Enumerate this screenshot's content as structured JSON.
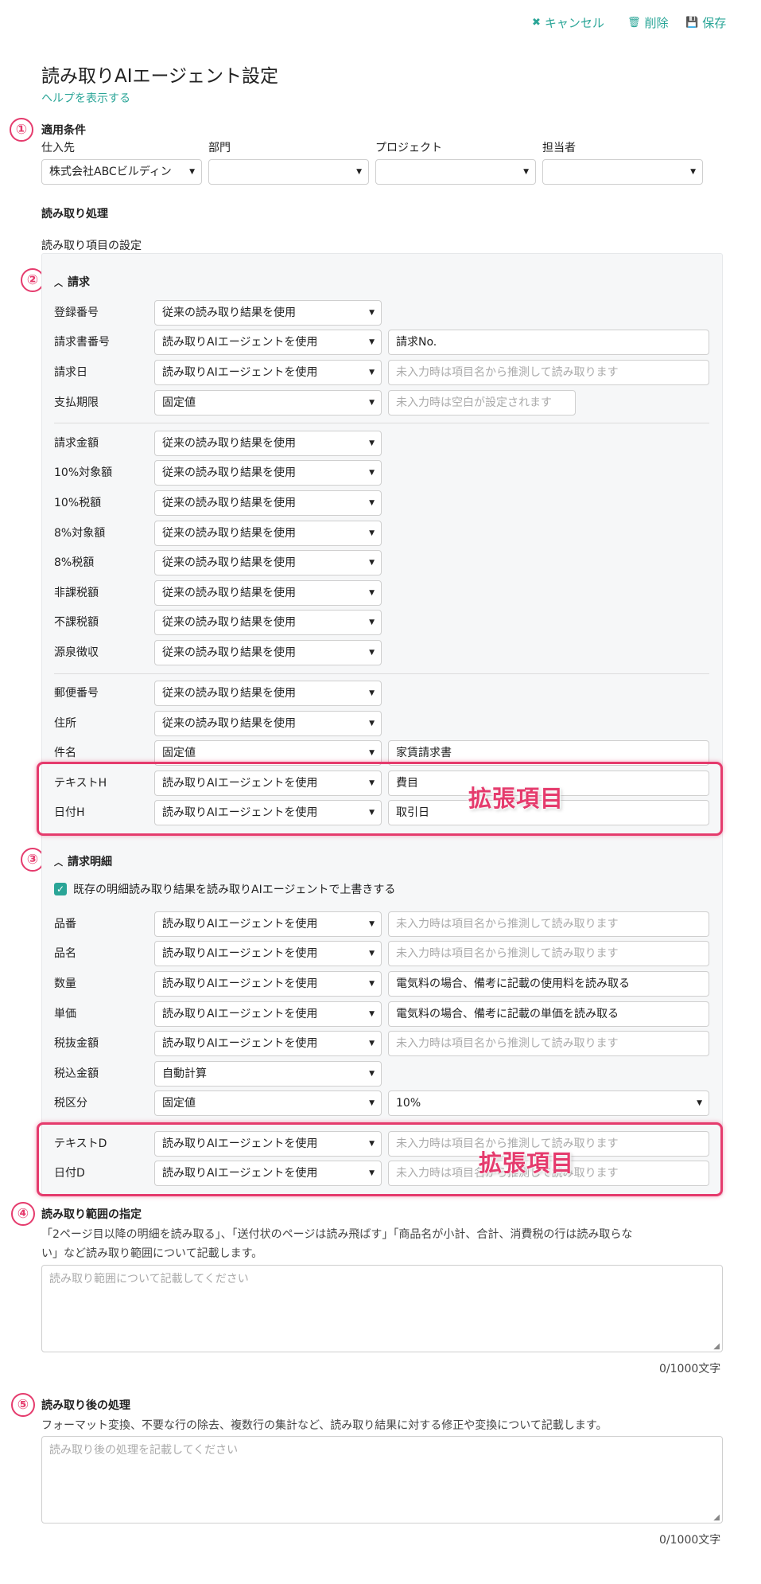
{
  "toolbar": {
    "cancel": "キャンセル",
    "delete": "削除",
    "save": "保存"
  },
  "page": {
    "title": "読み取りAIエージェント設定",
    "help_link": "ヘルプを表示する"
  },
  "conditions": {
    "heading": "適用条件",
    "fields": [
      {
        "label": "仕入先",
        "value": "株式会社ABCビルディン"
      },
      {
        "label": "部門",
        "value": ""
      },
      {
        "label": "プロジェクト",
        "value": ""
      },
      {
        "label": "担当者",
        "value": ""
      }
    ]
  },
  "processing": {
    "heading": "読み取り処理",
    "subheading": "読み取り項目の設定"
  },
  "invoice": {
    "heading": "請求",
    "rows": [
      {
        "label": "登録番号",
        "mode": "従来の読み取り結果を使用",
        "text": ""
      },
      {
        "label": "請求書番号",
        "mode": "読み取りAIエージェントを使用",
        "text": "請求No."
      },
      {
        "label": "請求日",
        "mode": "読み取りAIエージェントを使用",
        "placeholder": "未入力時は項目名から推測して読み取ります"
      },
      {
        "label": "支払期限",
        "mode": "固定値",
        "placeholder": "未入力時は空白が設定されます"
      },
      {
        "label": "請求金額",
        "mode": "従来の読み取り結果を使用"
      },
      {
        "label": "10%対象額",
        "mode": "従来の読み取り結果を使用"
      },
      {
        "label": "10%税額",
        "mode": "従来の読み取り結果を使用"
      },
      {
        "label": "8%対象額",
        "mode": "従来の読み取り結果を使用"
      },
      {
        "label": "8%税額",
        "mode": "従来の読み取り結果を使用"
      },
      {
        "label": "非課税額",
        "mode": "従来の読み取り結果を使用"
      },
      {
        "label": "不課税額",
        "mode": "従来の読み取り結果を使用"
      },
      {
        "label": "源泉徴収",
        "mode": "従来の読み取り結果を使用"
      },
      {
        "label": "郵便番号",
        "mode": "従来の読み取り結果を使用"
      },
      {
        "label": "住所",
        "mode": "従来の読み取り結果を使用"
      },
      {
        "label": "件名",
        "mode": "固定値",
        "text": "家賃請求書"
      },
      {
        "label": "テキストH",
        "mode": "読み取りAIエージェントを使用",
        "text": "費目"
      },
      {
        "label": "日付H",
        "mode": "読み取りAIエージェントを使用",
        "text": "取引日"
      }
    ]
  },
  "details": {
    "heading": "請求明細",
    "overwrite_label": "既存の明細読み取り結果を読み取りAIエージェントで上書きする",
    "overwrite_checked": true,
    "rows": [
      {
        "label": "品番",
        "mode": "読み取りAIエージェントを使用",
        "placeholder": "未入力時は項目名から推測して読み取ります"
      },
      {
        "label": "品名",
        "mode": "読み取りAIエージェントを使用",
        "placeholder": "未入力時は項目名から推測して読み取ります"
      },
      {
        "label": "数量",
        "mode": "読み取りAIエージェントを使用",
        "text": "電気料の場合、備考に記載の使用料を読み取る"
      },
      {
        "label": "単価",
        "mode": "読み取りAIエージェントを使用",
        "text": "電気料の場合、備考に記載の単価を読み取る"
      },
      {
        "label": "税抜金額",
        "mode": "読み取りAIエージェントを使用",
        "placeholder": "未入力時は項目名から推測して読み取ります"
      },
      {
        "label": "税込金額",
        "mode": "自動計算"
      },
      {
        "label": "税区分",
        "mode": "固定値",
        "select_value": "10%"
      },
      {
        "label": "テキストD",
        "mode": "読み取りAIエージェントを使用",
        "placeholder": "未入力時は項目名から推測して読み取ります"
      },
      {
        "label": "日付D",
        "mode": "読み取りAIエージェントを使用",
        "placeholder": "未入力時は項目名から推測して読み取ります"
      }
    ]
  },
  "annotations": {
    "extension_label": "拡張項目",
    "markers": [
      "①",
      "②",
      "③",
      "④",
      "⑤"
    ]
  },
  "range": {
    "heading": "読み取り範囲の指定",
    "desc1": "「2ページ目以降の明細を読み取る」、「送付状のページは読み飛ばす」「商品名が小計、合計、消費税の行は読み取らな",
    "desc2": "い」など読み取り範囲について記載します。",
    "placeholder": "読み取り範囲について記載してください",
    "counter": "0/1000文字"
  },
  "post": {
    "heading": "読み取り後の処理",
    "desc": "フォーマット変換、不要な行の除去、複数行の集計など、読み取り結果に対する修正や変換について記載します。",
    "placeholder": "読み取り後の処理を記載してください",
    "counter": "0/1000文字"
  },
  "colors": {
    "accent": "#2aa597",
    "annotation": "#e53b6d",
    "panel_bg": "#f6f7f8"
  },
  "icons": {
    "cancel": "close-icon",
    "delete": "trash-icon",
    "save": "floppy-icon",
    "collapse": "chevron-up-icon",
    "dropdown": "caret-down-icon"
  }
}
